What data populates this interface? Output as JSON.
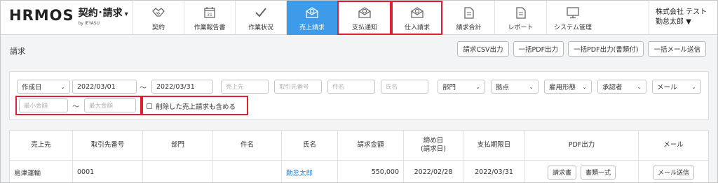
{
  "header": {
    "logo": "HRMOS",
    "product": "契約･請求",
    "product_caret": "▾",
    "sub": "by IEYASU",
    "nav": [
      {
        "label": "契約",
        "icon": "handshake-icon"
      },
      {
        "label": "作業報告書",
        "icon": "calendar-icon"
      },
      {
        "label": "作業状況",
        "icon": "checkmark-icon"
      },
      {
        "label": "売上請求",
        "icon": "mail-yen-icon",
        "active": true
      },
      {
        "label": "支払通知",
        "icon": "mail-yen-icon"
      },
      {
        "label": "仕入請求",
        "icon": "mail-yen-icon"
      },
      {
        "label": "請求合計",
        "icon": "document-icon"
      },
      {
        "label": "レポート",
        "icon": "document-icon"
      },
      {
        "label": "システム管理",
        "icon": "monitor-icon"
      }
    ],
    "company": "株式会社 テスト",
    "user": "勤怠太郎",
    "user_caret": "▼"
  },
  "page": {
    "title": "請求",
    "buttons": [
      "請求CSV出力",
      "一括PDF出力",
      "一括PDF出力(書類付)",
      "一括メール送信"
    ]
  },
  "filters": {
    "date_type": "作成日",
    "date_from": "2022/03/01",
    "tilde": "〜",
    "date_to": "2022/03/31",
    "customer_ph": "売上先",
    "customer_no_ph": "取引先番号",
    "subject_ph": "件名",
    "name_ph": "氏名",
    "dept": "部門",
    "base": "拠点",
    "employment": "雇用形態",
    "approver": "承認者",
    "mail": "メール",
    "min_ph": "最小金額",
    "max_ph": "最大金額",
    "include_deleted": "削除した売上請求も含める"
  },
  "table": {
    "headers": [
      "売上先",
      "取引先番号",
      "部門",
      "件名",
      "氏名",
      "請求金額",
      "締め日",
      "(請求日)",
      "支払期限日",
      "PDF出力",
      "メール"
    ],
    "row": {
      "customer": "島津運輸",
      "customer_no": "0001",
      "dept": "",
      "subject": "",
      "name": "勤怠太郎",
      "amount": "550,000",
      "closing": "2022/02/28",
      "due": "2022/03/31",
      "pdf_invoice": "請求書",
      "pdf_set": "書類一式",
      "mail": "メール送信"
    }
  },
  "colors": {
    "accent": "#3d9be9",
    "highlight": "#e0202e",
    "link": "#2a86d8"
  }
}
